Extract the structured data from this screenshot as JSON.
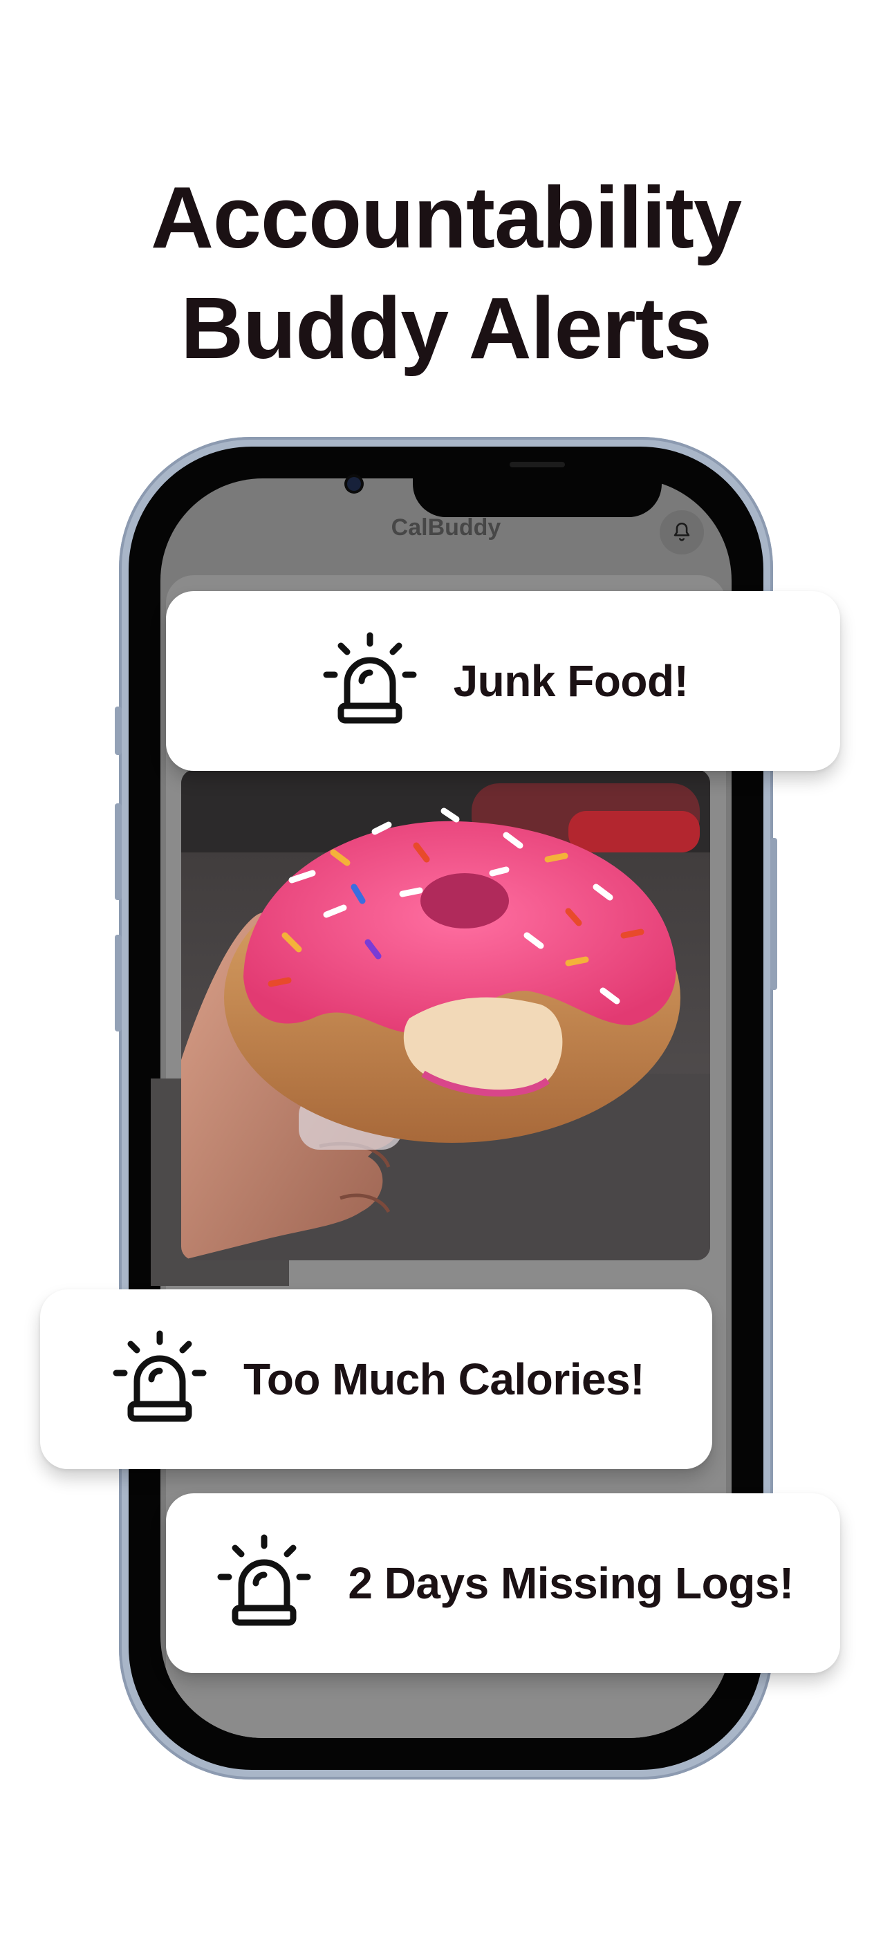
{
  "headline": {
    "line1": "Accountability",
    "line2": "Buddy Alerts"
  },
  "app": {
    "title": "CalBuddy",
    "header_icon": "bell-icon"
  },
  "photo": {
    "subject": "donut-photo"
  },
  "alerts": [
    {
      "icon": "siren-icon",
      "text": "Junk Food!"
    },
    {
      "icon": "siren-icon",
      "text": "Too Much Calories!"
    },
    {
      "icon": "siren-icon",
      "text": "2 Days Missing Logs!"
    }
  ],
  "colors": {
    "headline": "#1b1114",
    "phone_frame": "#a9b6c8",
    "screen_dim": "#7a7a7a",
    "ring_dark": "#1a1a1a",
    "ring_grey": "#9a9a9a",
    "ring_blue": "#2f5fa8",
    "ring_green": "#2f8a3a",
    "donut_icing": "#f0447e"
  }
}
